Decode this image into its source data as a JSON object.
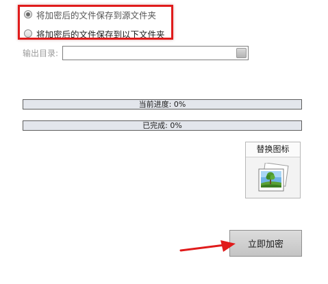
{
  "save_options": {
    "option_source": "将加密后的文件保存到源文件夹",
    "option_custom": "将加密后的文件保存到以下文件夹",
    "selected": "option_source"
  },
  "output": {
    "label": "输出目录:",
    "value": ""
  },
  "progress": {
    "current_label": "当前进度: 0%",
    "current_value": 0,
    "completed_label": "已完成: 0%",
    "completed_value": 0
  },
  "icon_panel": {
    "title": "替换图标",
    "preview_icon": "landscape-photo-icon"
  },
  "actions": {
    "encrypt_label": "立即加密"
  },
  "annotations": {
    "highlight_color": "#e01b1b",
    "arrow_color": "#e01b1b"
  }
}
